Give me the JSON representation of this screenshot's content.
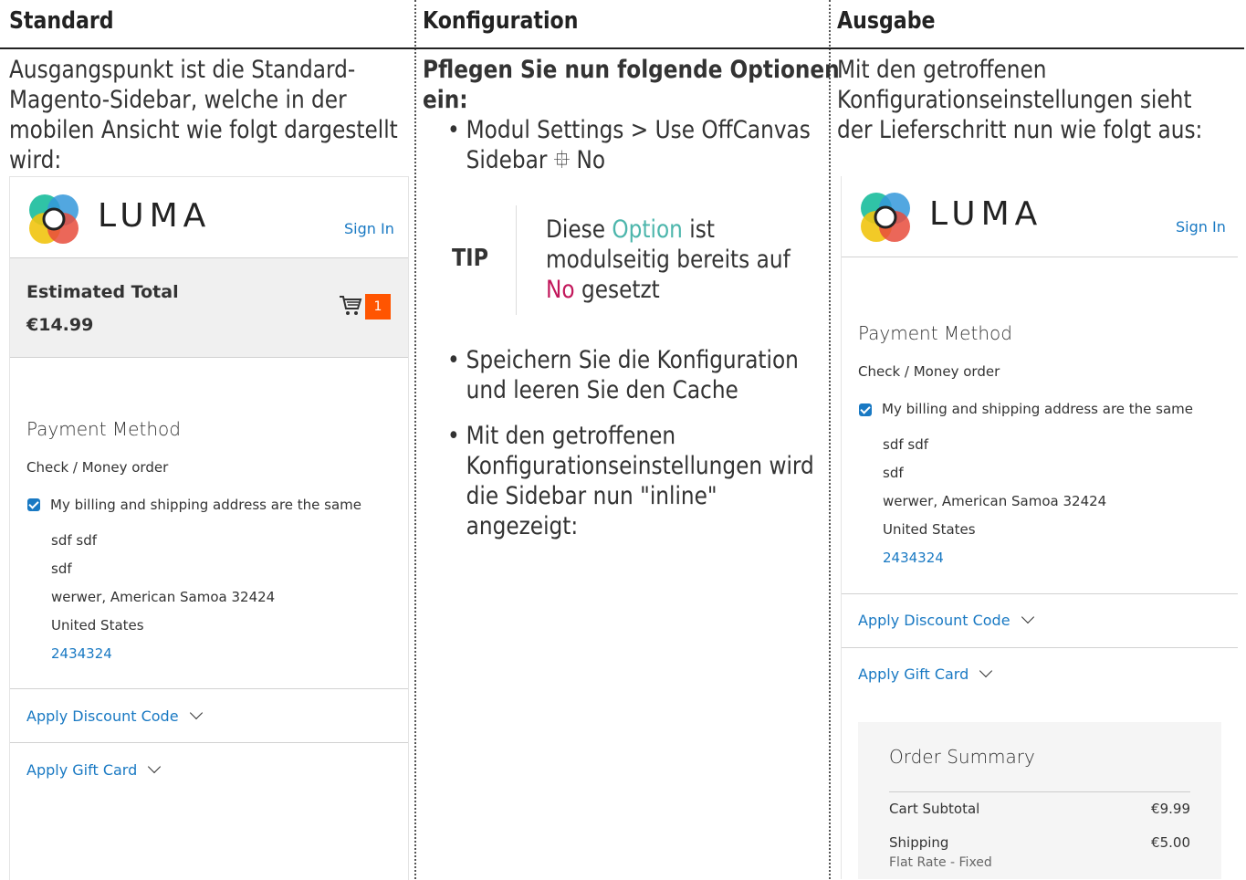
{
  "headers": {
    "col1": "Standard",
    "col2": "Konfiguration",
    "col3": "Ausgabe"
  },
  "col1": {
    "intro": "Ausgangspunkt ist die Standard-Magento-Sidebar, welche in der mobilen Ansicht wie folgt dargestellt wird:"
  },
  "col2": {
    "intro": "Pflegen Sie nun folgende Optionen ein:",
    "bullet1": "Modul Settings > Use OffCanvas Sidebar ⯐ No",
    "tip": {
      "label": "TIP",
      "text_a": "Diese ",
      "text_option": "Option",
      "text_b": " ist modulseitig bereits auf ",
      "text_no": "No",
      "text_c": " gesetzt"
    },
    "bullet2": "Speichern Sie die Konfiguration und leeren Sie den Cache",
    "bullet3": "Mit den getroffenen Konfigurationseinstellungen wird die Sidebar nun \"inline\" angezeigt:"
  },
  "col3": {
    "intro": "Mit den getroffenen Konfigurationseinstellungen sieht der Lieferschritt nun wie folgt aus:"
  },
  "shop": {
    "logo_text": "LUMA",
    "sign_in": "Sign In",
    "estimated_total_label": "Estimated Total",
    "estimated_total_value": "€14.99",
    "cart_count": "1",
    "payment_method_title": "Payment Method",
    "payment_option": "Check / Money order",
    "same_address_label": "My billing and shipping address are the same",
    "address": {
      "name": "sdf sdf",
      "street": "sdf",
      "city_line": "werwer, American Samoa 32424",
      "country": "United States",
      "phone": "2434324"
    },
    "apply_discount": "Apply Discount Code",
    "apply_gift_card": "Apply Gift Card",
    "order_summary": {
      "title": "Order Summary",
      "cart_subtotal_label": "Cart Subtotal",
      "cart_subtotal_value": "€9.99",
      "shipping_label": "Shipping",
      "shipping_value": "€5.00",
      "shipping_method": "Flat Rate - Fixed"
    }
  },
  "colors": {
    "link": "#1979c3",
    "badge": "#ff5501",
    "tip_green": "#4db6ac",
    "tip_red": "#c2185b"
  }
}
